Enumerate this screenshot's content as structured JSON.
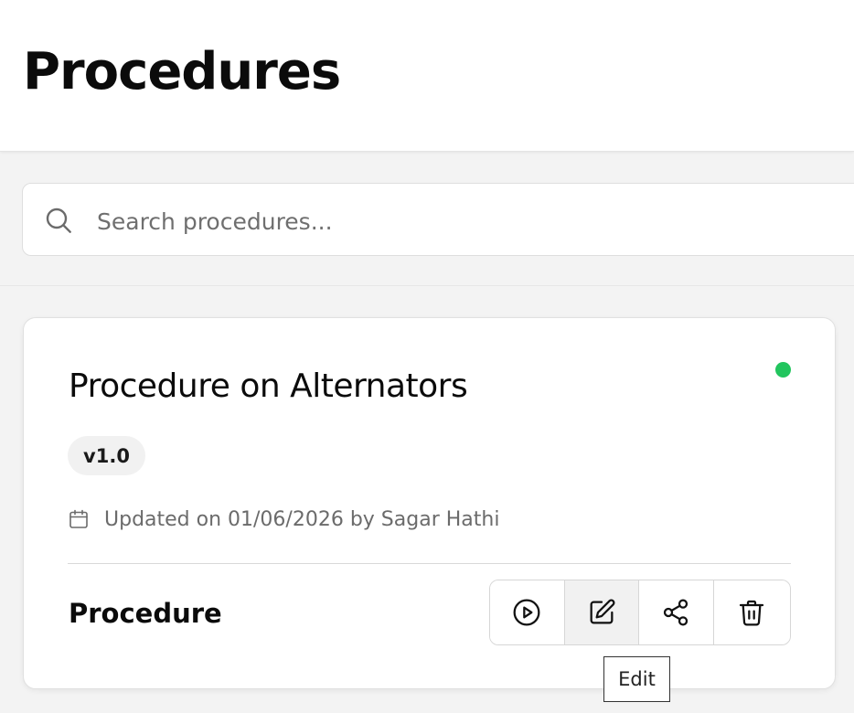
{
  "header": {
    "title": "Procedures"
  },
  "search": {
    "placeholder": "Search procedures..."
  },
  "card": {
    "title": "Procedure on Alternators",
    "status_color": "#22c55e",
    "version": "v1.0",
    "updated": "Updated on 01/06/2026 by Sagar Hathi",
    "footer_label": "Procedure",
    "actions": [
      {
        "icon": "play-icon"
      },
      {
        "icon": "edit-icon"
      },
      {
        "icon": "share-icon"
      },
      {
        "icon": "trash-icon"
      }
    ]
  },
  "tooltip": {
    "text": "Edit"
  }
}
